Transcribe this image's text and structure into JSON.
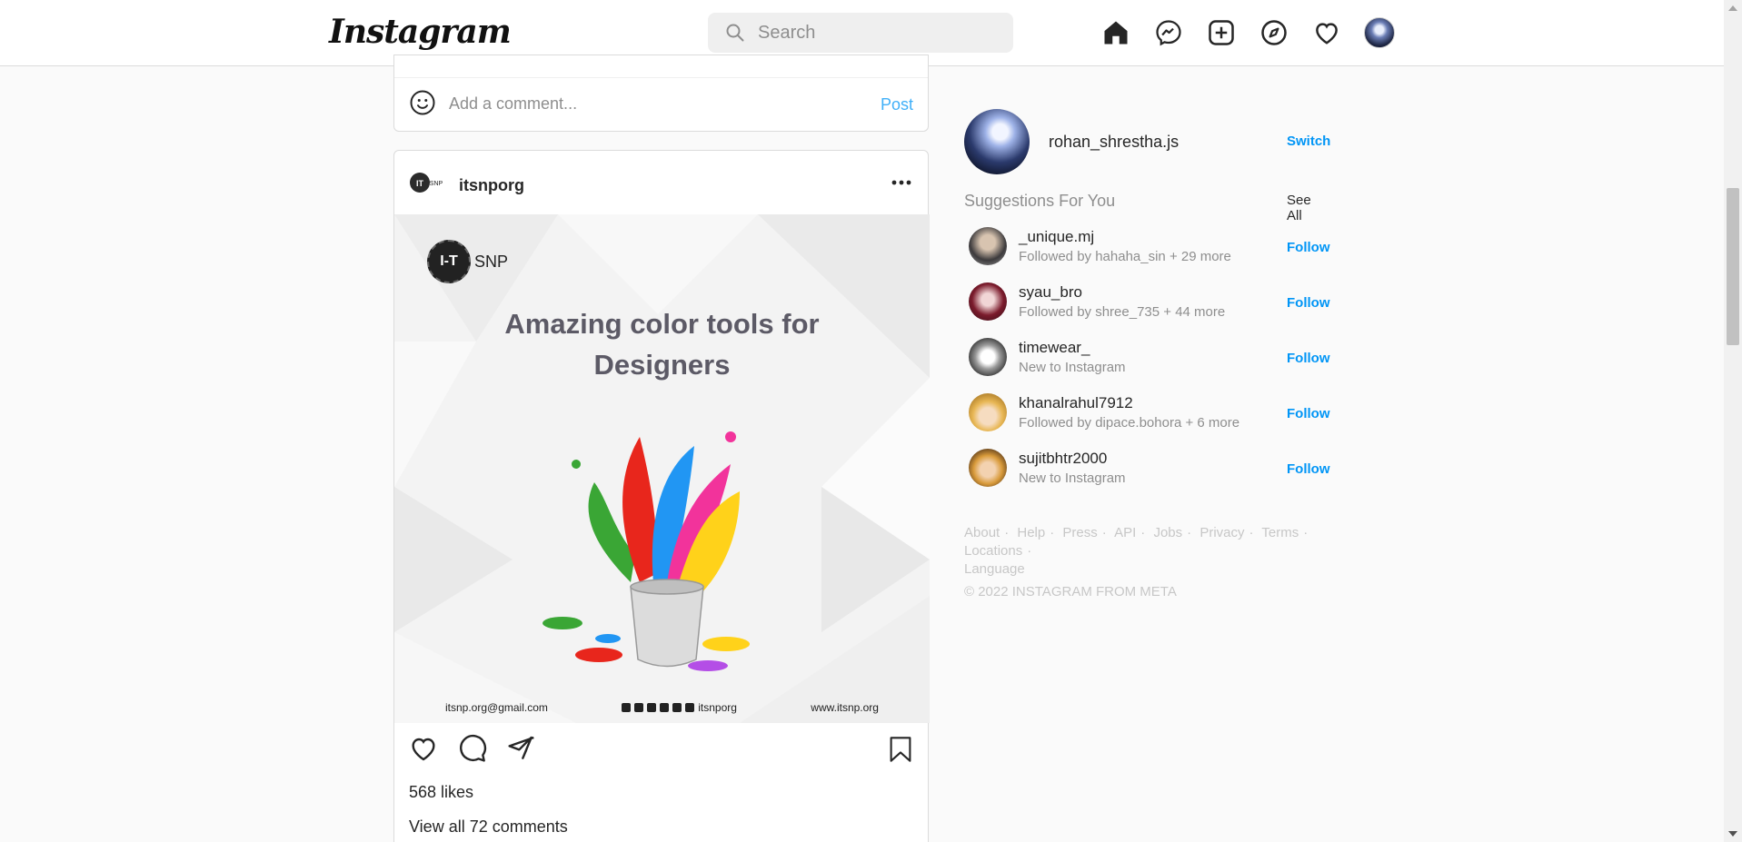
{
  "header": {
    "logo_text": "Instagram",
    "search_placeholder": "Search",
    "icons": [
      "home-icon",
      "messenger-icon",
      "new-post-icon",
      "explore-icon",
      "activity-heart-icon",
      "profile-avatar"
    ]
  },
  "prev_post": {
    "comment_placeholder": "Add a comment...",
    "post_label": "Post"
  },
  "post": {
    "username": "itsnporg",
    "image": {
      "brand_initials": "I-T",
      "brand_name": "SNP",
      "headline_line1": "Amazing color tools for",
      "headline_line2": "Designers",
      "email": "itsnp.org@gmail.com",
      "handle": "itsnporg",
      "website": "www.itsnp.org"
    },
    "likes": "568 likes",
    "view_comments": "View all 72 comments"
  },
  "sidebar": {
    "username": "rohan_shrestha.js",
    "switch_label": "Switch",
    "suggestions_title": "Suggestions For You",
    "see_all_label": "See All",
    "suggestions": [
      {
        "name": "_unique.mj",
        "sub": "Followed by hahaha_sin + 29 more",
        "follow": "Follow"
      },
      {
        "name": "syau_bro",
        "sub": "Followed by shree_735 + 44 more",
        "follow": "Follow"
      },
      {
        "name": "timewear_",
        "sub": "New to Instagram",
        "follow": "Follow"
      },
      {
        "name": "khanalrahul7912",
        "sub": "Followed by dipace.bohora + 6 more",
        "follow": "Follow"
      },
      {
        "name": "sujitbhtr2000",
        "sub": "New to Instagram",
        "follow": "Follow"
      }
    ],
    "footer_links": [
      "About",
      "Help",
      "Press",
      "API",
      "Jobs",
      "Privacy",
      "Terms",
      "Locations",
      "Language"
    ],
    "copyright": "© 2022 INSTAGRAM FROM META"
  },
  "colors": {
    "accent": "#0095f6",
    "muted": "#8e8e8e",
    "border": "#dbdbdb"
  }
}
